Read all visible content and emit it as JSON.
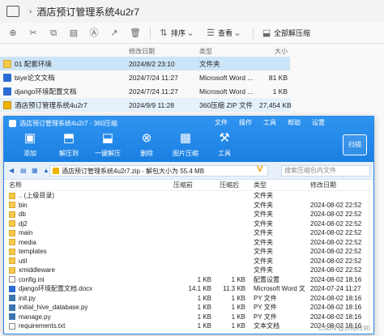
{
  "explorer": {
    "title": "酒店预订管理系统4u2r7",
    "toolbar": {
      "sort_label": "排序",
      "view_label": "查看",
      "extract_label": "全部解压缩"
    },
    "columns": {
      "date": "修改日期",
      "type": "类型",
      "size": "大小"
    },
    "files": [
      {
        "name": "01 配套环境",
        "date": "2024/8/2 23:10",
        "type": "文件夹",
        "size": "",
        "icon": "folder-icon"
      },
      {
        "name": "biye论文文档",
        "date": "2024/7/24 11:27",
        "type": "Microsoft Word ...",
        "size": "81 KB",
        "icon": "word-icon"
      },
      {
        "name": "django环境配置文档",
        "date": "2024/7/24 11:27",
        "type": "Microsoft Word ...",
        "size": "1 KB",
        "icon": "word-icon"
      },
      {
        "name": "酒店预订管理系统4u2r7",
        "date": "2024/9/9 11:28",
        "type": "360压缩 ZIP 文件",
        "size": "27,454 KB",
        "icon": "zip-icon"
      }
    ]
  },
  "zip_window": {
    "title": "酒店预订管理系统4u2r7 - 360压缩",
    "menu": [
      "文件",
      "操作",
      "工具",
      "帮助",
      "设置"
    ],
    "tools": [
      {
        "label": "添加",
        "icon": "add-icon"
      },
      {
        "label": "解压到",
        "icon": "extract-to-icon"
      },
      {
        "label": "一键解压",
        "icon": "one-click-extract-icon"
      },
      {
        "label": "删除",
        "icon": "delete-icon"
      },
      {
        "label": "图片压缩",
        "icon": "image-compress-icon"
      },
      {
        "label": "工具",
        "icon": "tools-icon"
      }
    ],
    "scan_label": "扫描",
    "path": "酒店预订管理系统4u2r7.zip - 解包大小为 55.4 MB",
    "search_placeholder": "搜索压缩包内文件",
    "columns": {
      "name": "名称",
      "compressed": "压缩前",
      "original": "压缩后",
      "type": "类型",
      "date": "修改日期"
    },
    "rows": [
      {
        "name": ".. (上级目录)",
        "compressed": "",
        "original": "",
        "type": "文件夹",
        "date": "",
        "icon": "up-folder-icon"
      },
      {
        "name": "bin",
        "compressed": "",
        "original": "",
        "type": "文件夹",
        "date": "2024-08-02 22:52",
        "icon": "folder-icon"
      },
      {
        "name": "db",
        "compressed": "",
        "original": "",
        "type": "文件夹",
        "date": "2024-08-02 22:52",
        "icon": "folder-icon"
      },
      {
        "name": "dj2",
        "compressed": "",
        "original": "",
        "type": "文件夹",
        "date": "2024-08-02 22:52",
        "icon": "folder-icon"
      },
      {
        "name": "main",
        "compressed": "",
        "original": "",
        "type": "文件夹",
        "date": "2024-08-02 22:52",
        "icon": "folder-icon"
      },
      {
        "name": "media",
        "compressed": "",
        "original": "",
        "type": "文件夹",
        "date": "2024-08-02 22:52",
        "icon": "folder-icon"
      },
      {
        "name": "templates",
        "compressed": "",
        "original": "",
        "type": "文件夹",
        "date": "2024-08-02 22:52",
        "icon": "folder-icon"
      },
      {
        "name": "util",
        "compressed": "",
        "original": "",
        "type": "文件夹",
        "date": "2024-08-02 22:52",
        "icon": "folder-icon"
      },
      {
        "name": "xmiddleware",
        "compressed": "",
        "original": "",
        "type": "文件夹",
        "date": "2024-08-02 22:52",
        "icon": "folder-icon"
      },
      {
        "name": "config.ini",
        "compressed": "1 KB",
        "original": "1 KB",
        "type": "配置设置",
        "date": "2024-08-02 18:16",
        "icon": "file-icon"
      },
      {
        "name": "django环境配置文档.docx",
        "compressed": "14.1 KB",
        "original": "11.3 KB",
        "type": "Microsoft Word 文档",
        "date": "2024-07-24 11:27",
        "icon": "word-icon"
      },
      {
        "name": "init.py",
        "compressed": "1 KB",
        "original": "1 KB",
        "type": "PY 文件",
        "date": "2024-08-02 18:16",
        "icon": "python-icon"
      },
      {
        "name": "initial_hive_database.py",
        "compressed": "1 KB",
        "original": "1 KB",
        "type": "PY 文件",
        "date": "2024-08-02 18:16",
        "icon": "python-icon"
      },
      {
        "name": "manage.py",
        "compressed": "1 KB",
        "original": "1 KB",
        "type": "PY 文件",
        "date": "2024-08-02 18:16",
        "icon": "python-icon"
      },
      {
        "name": "requirements.txt",
        "compressed": "1 KB",
        "original": "1 KB",
        "type": "文本文档",
        "date": "2024-08-02 18:16",
        "icon": "file-icon"
      }
    ],
    "watermark": "CSDN @zhiije190"
  }
}
